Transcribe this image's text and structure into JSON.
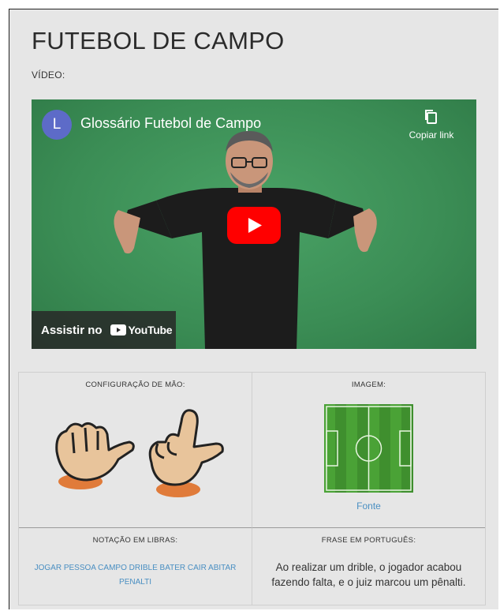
{
  "page": {
    "title": "FUTEBOL DE CAMPO",
    "video_label": "VÍDEO:"
  },
  "video": {
    "channel_initial": "L",
    "title": "Glossário Futebol de Campo",
    "copy_link_label": "Copiar link",
    "watch_on_label": "Assistir no",
    "youtube_label": "YouTube"
  },
  "details": {
    "hand_config_label": "CONFIGURAÇÃO DE MÃO:",
    "image_label": "IMAGEM:",
    "image_source_link": "Fonte",
    "libras_notation_label": "NOTAÇÃO EM LIBRAS:",
    "libras_notation": "JOGAR PESSOA CAMPO DRIBLE BATER CAIR ABITAR PENALTI",
    "portuguese_phrase_label": "FRASE EM PORTUGUÊS:",
    "portuguese_phrase": "Ao realizar um drible, o jogador acabou fazendo falta, e o juiz marcou um pênalti."
  },
  "colors": {
    "page_bg": "#e6e6e6",
    "video_green": "#3e8f57",
    "link_blue": "#4a8fc2",
    "play_red": "#ff0000",
    "avatar_purple": "#5d6bc8"
  }
}
